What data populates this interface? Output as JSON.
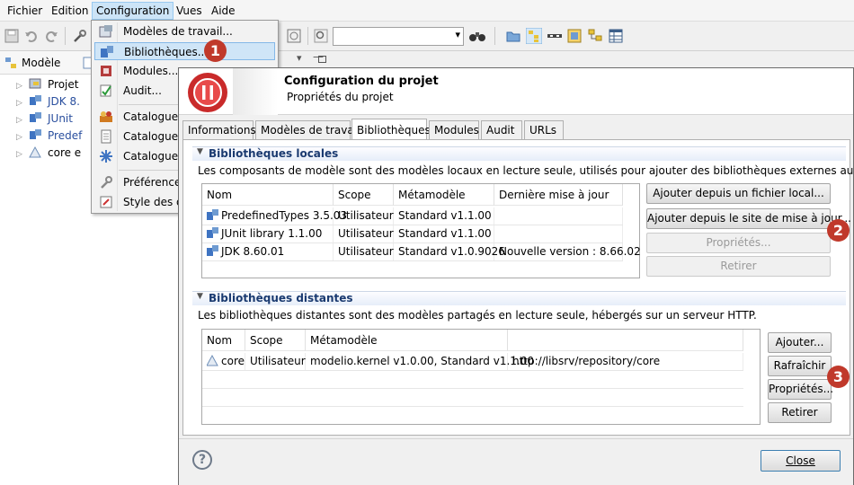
{
  "menubar": {
    "items": [
      "Fichier",
      "Edition",
      "Configuration",
      "Vues",
      "Aide"
    ]
  },
  "left_panel": {
    "tab_label": "Modèle",
    "tree": [
      "Projet",
      "JDK 8.",
      "JUnit",
      "Predef",
      "core e"
    ]
  },
  "config_menu": {
    "items": [
      "Modèles de travail...",
      "Bibliothèques...",
      "Modules...",
      "Audit...",
      "Catalogues",
      "Catalogue d",
      "Catalogue d",
      "Préférences",
      "Style des dia"
    ]
  },
  "badges": [
    "1",
    "2",
    "3"
  ],
  "dialog": {
    "title": "Configuration du projet",
    "subtitle": "Propriétés du projet",
    "tabs": [
      "Informations",
      "Modèles de travail",
      "Bibliothèques",
      "Modules",
      "Audit",
      "URLs"
    ],
    "local": {
      "header": "Bibliothèques locales",
      "description": "Les composants de modèle sont des modèles locaux en lecture seule, utilisés pour ajouter des bibliothèques externes au projet.",
      "columns": [
        "Nom",
        "Scope",
        "Métamodèle",
        "Dernière mise à jour"
      ],
      "rows": [
        [
          "PredefinedTypes 3.5.03",
          "Utilisateur",
          "Standard v1.1.00",
          ""
        ],
        [
          "JUnit library 1.1.00",
          "Utilisateur",
          "Standard v1.1.00",
          ""
        ],
        [
          "JDK 8.60.01",
          "Utilisateur",
          "Standard v1.0.9026",
          "Nouvelle version : 8.66.02"
        ]
      ],
      "buttons": [
        "Ajouter depuis un fichier local...",
        "Ajouter depuis le site de mise à jour...",
        "Propriétés...",
        "Retirer"
      ]
    },
    "remote": {
      "header": "Bibliothèques distantes",
      "description": "Les bibliothèques distantes sont des modèles partagés en lecture seule, hébergés sur un serveur HTTP.",
      "columns": [
        "Nom",
        "Scope",
        "Métamodèle",
        ""
      ],
      "rows": [
        [
          "core",
          "Utilisateur",
          "modelio.kernel v1.0.00, Standard v1.1.00",
          "http://libsrv/repository/core"
        ]
      ],
      "buttons": [
        "Ajouter...",
        "Rafraîchir",
        "Propriétés...",
        "Retirer"
      ]
    },
    "help_label": "?",
    "close_label": "Close"
  },
  "colors": {
    "badge": "#c0392b",
    "menu_highlight": "#cfe5f7",
    "section_text": "#1a3a70"
  }
}
